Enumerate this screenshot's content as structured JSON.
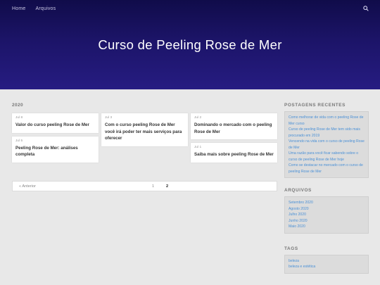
{
  "nav": {
    "items": [
      "Home",
      "Arquivos"
    ]
  },
  "header": {
    "title": "Curso de Peeling Rose de Mer"
  },
  "main": {
    "year": "2020",
    "columns": [
      [
        {
          "date": "Jul 8",
          "title": "Valor do curso peeling Rose de Mer"
        },
        {
          "date": "Jul 5",
          "title": "Peeling Rose de Mer: análises completa"
        }
      ],
      [
        {
          "date": "Jul 3",
          "title": "Com o curso peeling Rose de Mer você irá poder ter mais serviços para oferecer"
        }
      ],
      [
        {
          "date": "Jul 2",
          "title": "Dominando o mercado com o peeling Rose de Mer"
        },
        {
          "date": "Jul 1",
          "title": "Saiba mais sobre peeling Rose de Mer"
        }
      ]
    ]
  },
  "pager": {
    "prev": "« Anterior",
    "page1": "1",
    "page2": "2"
  },
  "sidebar": {
    "recent": {
      "title": "POSTAGENS RECENTES",
      "items": [
        "Como melhorar de vida com o peeling Rose de Mer curso",
        "Curso de peeling Rose de Mer tem sido mais procurado em 2019",
        "Vencendo na vida com o curso de peeling Rose de Mer",
        "Uma razão para você ficar sabendo sobre o curso de peeling Rose de Mer hoje",
        "Como se destacar no mercado com o curso de peeling Rose de Mer"
      ]
    },
    "archives": {
      "title": "ARQUIVOS",
      "items": [
        "Setembro 2020",
        "Agosto 2020",
        "Julho 2020",
        "Junho 2020",
        "Maio 2020"
      ]
    },
    "tags": {
      "title": "TAGS",
      "items": [
        "beleza",
        "beleza e estética"
      ]
    }
  },
  "colors": {
    "hero_top": "#100c4a",
    "hero_bottom": "#261c82",
    "link": "#4a90d6"
  }
}
